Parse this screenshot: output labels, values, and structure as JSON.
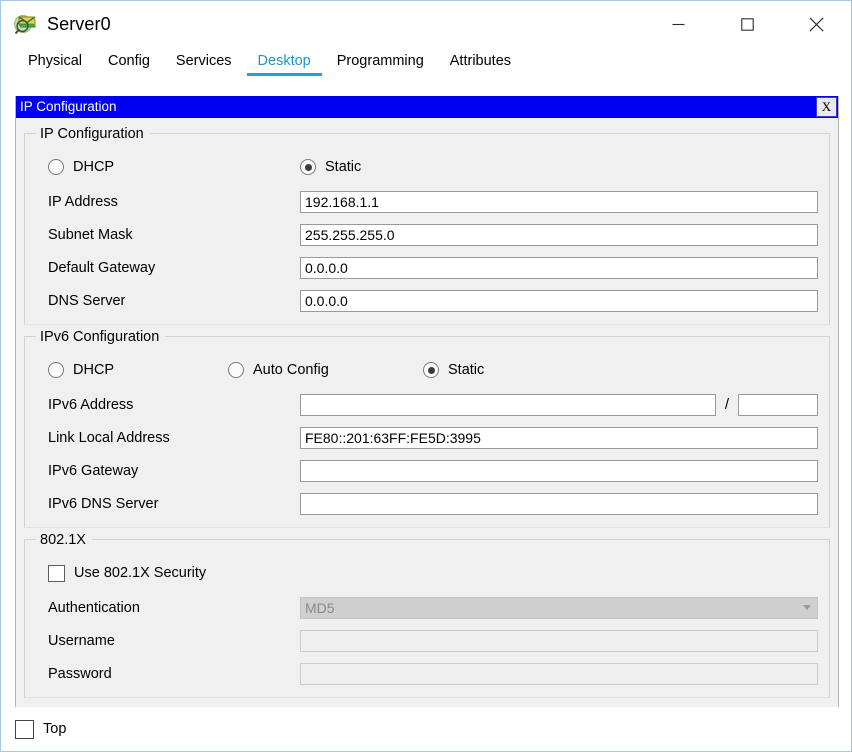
{
  "window": {
    "title": "Server0",
    "icon": "server-device-icon",
    "controls": {
      "minimize": "minimize-icon",
      "maximize": "maximize-icon",
      "close": "close-icon"
    }
  },
  "tabs": [
    {
      "label": "Physical",
      "active": false
    },
    {
      "label": "Config",
      "active": false
    },
    {
      "label": "Services",
      "active": false
    },
    {
      "label": "Desktop",
      "active": true
    },
    {
      "label": "Programming",
      "active": false
    },
    {
      "label": "Attributes",
      "active": false
    }
  ],
  "colors": {
    "accent": "#21a3cd",
    "panel_title_bg": "#0000f0",
    "panel_bg": "#f0f0f0",
    "window_border": "#9fc7e8",
    "disabled_text": "#8a8a8a"
  },
  "panel": {
    "title": "IP Configuration",
    "close_label": "X"
  },
  "ipv4": {
    "group_label": "IP Configuration",
    "mode_dhcp": {
      "label": "DHCP",
      "selected": false
    },
    "mode_static": {
      "label": "Static",
      "selected": true
    },
    "fields": [
      {
        "label": "IP Address",
        "value": "192.168.1.1",
        "placeholder": ""
      },
      {
        "label": "Subnet Mask",
        "value": "255.255.255.0",
        "placeholder": ""
      },
      {
        "label": "Default Gateway",
        "value": "0.0.0.0",
        "placeholder": ""
      },
      {
        "label": "DNS Server",
        "value": "0.0.0.0",
        "placeholder": ""
      }
    ]
  },
  "ipv6": {
    "group_label": "IPv6 Configuration",
    "mode_dhcp": {
      "label": "DHCP",
      "selected": false
    },
    "mode_auto": {
      "label": "Auto Config",
      "selected": false
    },
    "mode_static": {
      "label": "Static",
      "selected": true
    },
    "address": {
      "label": "IPv6 Address",
      "value": "",
      "prefix_value": "",
      "separator": "/"
    },
    "link_local": {
      "label": "Link Local Address",
      "value": "FE80::201:63FF:FE5D:3995"
    },
    "gateway": {
      "label": "IPv6 Gateway",
      "value": ""
    },
    "dns": {
      "label": "IPv6 DNS Server",
      "value": ""
    }
  },
  "dot1x": {
    "group_label": "802.1X",
    "use_security": {
      "label": "Use 802.1X Security",
      "checked": false
    },
    "authentication": {
      "label": "Authentication",
      "value": "MD5",
      "enabled": false
    },
    "username": {
      "label": "Username",
      "value": "",
      "enabled": false
    },
    "password": {
      "label": "Password",
      "value": "",
      "enabled": false
    }
  },
  "footer": {
    "top_checkbox": {
      "label": "Top",
      "checked": false
    }
  }
}
